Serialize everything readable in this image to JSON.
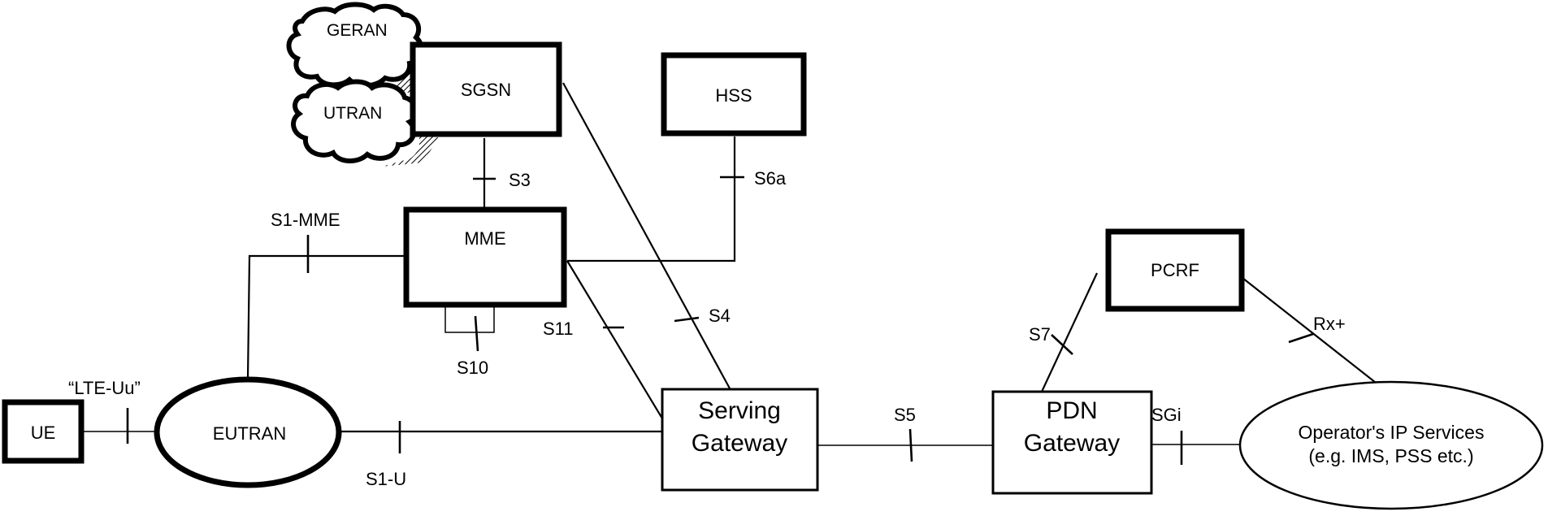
{
  "nodes": {
    "geran": "GERAN",
    "utran": "UTRAN",
    "sgsn": "SGSN",
    "hss": "HSS",
    "mme": "MME",
    "pcrf": "PCRF",
    "ue": "UE",
    "eutran": "EUTRAN",
    "serving_gateway": [
      "Serving",
      "Gateway"
    ],
    "pdn_gateway": [
      "PDN",
      "Gateway"
    ],
    "operator_services": [
      "Operator's IP Services",
      "(e.g. IMS, PSS etc.)"
    ]
  },
  "interfaces": {
    "s3": "S3",
    "s6a": "S6a",
    "s1_mme": "S1-MME",
    "s10": "S10",
    "s11": "S11",
    "s4": "S4",
    "s7": "S7",
    "rx_plus": "Rx+",
    "lte_uu": "“LTE-Uu”",
    "s1_u": "S1-U",
    "s5": "S5",
    "sgi": "SGi"
  },
  "colors": {
    "stroke": "#000000",
    "background": "#ffffff"
  }
}
